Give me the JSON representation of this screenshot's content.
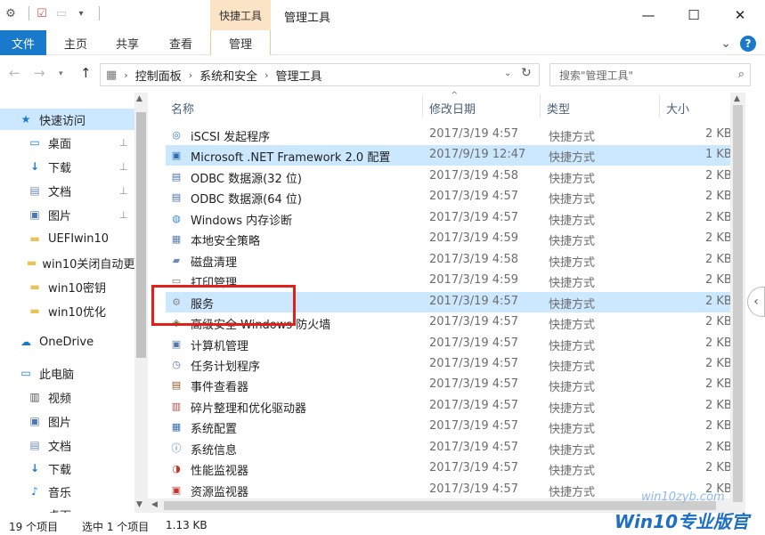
{
  "window": {
    "context_tab_group": "快捷工具",
    "title": "管理工具",
    "minimize_glyph": "—",
    "maximize_glyph": "☐",
    "close_glyph": "✕"
  },
  "ribbon": {
    "tabs": [
      "文件",
      "主页",
      "共享",
      "查看",
      "管理"
    ],
    "expand_glyph": "⌄",
    "help_glyph": "?"
  },
  "address": {
    "crumbs": [
      "控制面板",
      "系统和安全",
      "管理工具"
    ],
    "search_placeholder": "搜索\"管理工具\""
  },
  "nav": {
    "items": [
      {
        "label": "快速访问",
        "icon": "star-icon",
        "pinned": false
      },
      {
        "label": "桌面",
        "icon": "desktop-icon",
        "pinned": true
      },
      {
        "label": "下载",
        "icon": "download-icon",
        "pinned": true
      },
      {
        "label": "文档",
        "icon": "document-icon",
        "pinned": true
      },
      {
        "label": "图片",
        "icon": "pictures-icon",
        "pinned": true
      },
      {
        "label": "UEFIwin10",
        "icon": "folder-icon",
        "pinned": false
      },
      {
        "label": "win10关闭自动更",
        "icon": "folder-icon",
        "pinned": false
      },
      {
        "label": "win10密钥",
        "icon": "folder-icon",
        "pinned": false
      },
      {
        "label": "win10优化",
        "icon": "folder-icon",
        "pinned": false
      },
      {
        "label": "OneDrive",
        "icon": "cloud-icon",
        "pinned": false
      },
      {
        "label": "此电脑",
        "icon": "computer-icon",
        "pinned": false
      },
      {
        "label": "视频",
        "icon": "video-icon",
        "pinned": false
      },
      {
        "label": "图片",
        "icon": "pictures-icon",
        "pinned": false
      },
      {
        "label": "文档",
        "icon": "document-icon",
        "pinned": false
      },
      {
        "label": "下载",
        "icon": "download-icon",
        "pinned": false
      },
      {
        "label": "音乐",
        "icon": "music-icon",
        "pinned": false
      },
      {
        "label": "桌面",
        "icon": "desktop-icon",
        "pinned": false
      }
    ]
  },
  "columns": {
    "name": "名称",
    "date": "修改日期",
    "type": "类型",
    "size": "大小"
  },
  "files": [
    {
      "name": "iSCSI 发起程序",
      "date": "2017/3/19 4:57",
      "type": "快捷方式",
      "size": "2 KB",
      "icon": "iscsi-icon",
      "selected": false
    },
    {
      "name": "Microsoft .NET Framework 2.0 配置",
      "date": "2017/9/19 12:47",
      "type": "快捷方式",
      "size": "1 KB",
      "icon": "dotnet-icon",
      "selected": true
    },
    {
      "name": "ODBC 数据源(32 位)",
      "date": "2017/3/19 4:58",
      "type": "快捷方式",
      "size": "2 KB",
      "icon": "odbc-icon",
      "selected": false
    },
    {
      "name": "ODBC 数据源(64 位)",
      "date": "2017/3/19 4:57",
      "type": "快捷方式",
      "size": "2 KB",
      "icon": "odbc-icon",
      "selected": false
    },
    {
      "name": "Windows 内存诊断",
      "date": "2017/3/19 4:57",
      "type": "快捷方式",
      "size": "2 KB",
      "icon": "memory-diagnostic-icon",
      "selected": false
    },
    {
      "name": "本地安全策略",
      "date": "2017/3/19 4:59",
      "type": "快捷方式",
      "size": "2 KB",
      "icon": "security-policy-icon",
      "selected": false
    },
    {
      "name": "磁盘清理",
      "date": "2017/3/19 4:58",
      "type": "快捷方式",
      "size": "2 KB",
      "icon": "disk-cleanup-icon",
      "selected": false
    },
    {
      "name": "打印管理",
      "date": "2017/3/19 4:59",
      "type": "快捷方式",
      "size": "2 KB",
      "icon": "printer-icon",
      "selected": false
    },
    {
      "name": "服务",
      "date": "2017/3/19 4:57",
      "type": "快捷方式",
      "size": "2 KB",
      "icon": "services-gear-icon",
      "selected": true
    },
    {
      "name": "高级安全 Windows 防火墙",
      "date": "2017/3/19 4:57",
      "type": "快捷方式",
      "size": "2 KB",
      "icon": "firewall-icon",
      "selected": false
    },
    {
      "name": "计算机管理",
      "date": "2017/3/19 4:57",
      "type": "快捷方式",
      "size": "2 KB",
      "icon": "computer-management-icon",
      "selected": false
    },
    {
      "name": "任务计划程序",
      "date": "2017/3/19 4:57",
      "type": "快捷方式",
      "size": "2 KB",
      "icon": "task-scheduler-icon",
      "selected": false
    },
    {
      "name": "事件查看器",
      "date": "2017/3/19 4:57",
      "type": "快捷方式",
      "size": "2 KB",
      "icon": "event-viewer-icon",
      "selected": false
    },
    {
      "name": "碎片整理和优化驱动器",
      "date": "2017/3/19 4:57",
      "type": "快捷方式",
      "size": "2 KB",
      "icon": "defrag-icon",
      "selected": false
    },
    {
      "name": "系统配置",
      "date": "2017/3/19 4:57",
      "type": "快捷方式",
      "size": "2 KB",
      "icon": "system-config-icon",
      "selected": false
    },
    {
      "name": "系统信息",
      "date": "2017/3/19 4:57",
      "type": "快捷方式",
      "size": "2 KB",
      "icon": "system-info-icon",
      "selected": false
    },
    {
      "name": "性能监视器",
      "date": "2017/3/19 4:57",
      "type": "快捷方式",
      "size": "2 KB",
      "icon": "performance-monitor-icon",
      "selected": false
    },
    {
      "name": "资源监视器",
      "date": "2017/3/19 4:57",
      "type": "快捷方式",
      "size": "2 KB",
      "icon": "resource-monitor-icon",
      "selected": false
    }
  ],
  "status": {
    "count": "19 个项目",
    "selection": "选中 1 个项目",
    "size": "1.13 KB"
  },
  "watermark": {
    "url": "win10zyb.com",
    "brand": "Win10专业版官网"
  },
  "colors": {
    "accent": "#1979ca",
    "selection": "#cce8ff",
    "context_tab": "#fbe3c6",
    "highlight_box": "#e0201b"
  }
}
